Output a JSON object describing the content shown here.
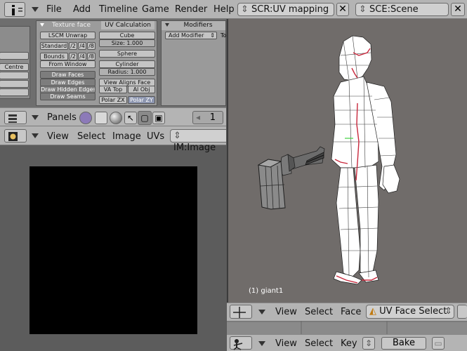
{
  "top_menu": {
    "items": [
      "File",
      "Add",
      "Timeline",
      "Game",
      "Render",
      "Help"
    ],
    "screen_field": "SCR:UV mapping",
    "scene_field": "SCE:Scene"
  },
  "buttons": {
    "side_buttons": [
      "Centre"
    ],
    "texture_face": {
      "tab": "Texture face",
      "draw_faces": "Draw Faces",
      "draw_edges": "Draw Edges",
      "draw_hidden_edges": "Draw Hidden Edges",
      "draw_seams": "Draw Seams"
    },
    "uv_calc": {
      "tab": "UV Calculation",
      "lscm": "LSCM Unwrap",
      "standard": "Standard",
      "bounds": "Bounds",
      "div2": "/2",
      "div4": "/4",
      "div8": "/8",
      "from_window": "From Window",
      "cube": "Cube",
      "size": "Size: 1.000",
      "sphere": "Sphere",
      "cylinder": "Cylinder",
      "radius": "Radius: 1.000",
      "view_aligns_face": "View Aligns Face",
      "va_top": "VA Top",
      "al_obj": "Al Obj",
      "polar_zx": "Polar ZX",
      "polar_zy": "Polar ZY"
    },
    "modifiers": {
      "tab": "Modifiers",
      "add_modifier": "Add Modifier",
      "to_label": "To"
    }
  },
  "panels_header": {
    "label": "Panels",
    "frame": "1"
  },
  "image_editor": {
    "menus": [
      "View",
      "Select",
      "Image",
      "UVs"
    ],
    "image_field": "IM:Image"
  },
  "view3d": {
    "object_label": "(1) giant1",
    "menus": [
      "View",
      "Select",
      "Face"
    ],
    "mode": "UV Face Select"
  },
  "timeline_header": {
    "menus": [
      "View",
      "Select",
      "Key"
    ],
    "bake": "Bake"
  },
  "colors": {
    "header_bg": "#b4b4b4",
    "viewport_bg": "#706c6a",
    "mesh_white": "#ffffff",
    "seam_red": "#c8283c"
  }
}
